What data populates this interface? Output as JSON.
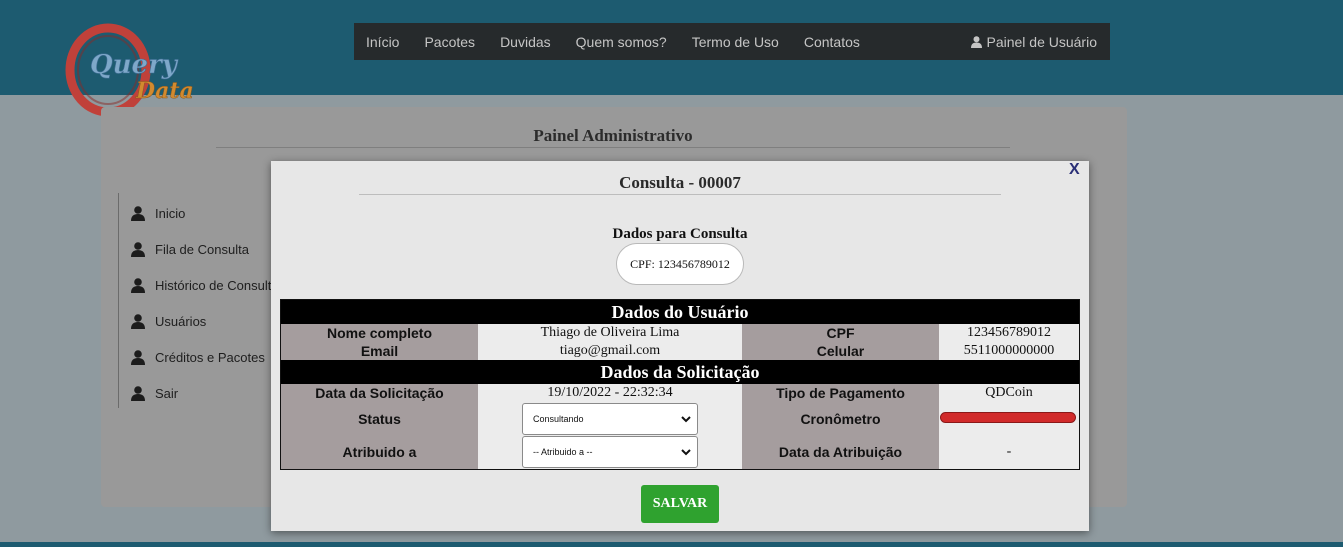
{
  "brand": {
    "logo_word1": "Query",
    "logo_word2": "Data"
  },
  "nav": {
    "items": [
      "Início",
      "Pacotes",
      "Duvidas",
      "Quem somos?",
      "Termo de Uso",
      "Contatos"
    ],
    "user_label": "Painel de Usuário",
    "user_icon": "user-icon"
  },
  "admin": {
    "title": "Painel Administrativo",
    "sidebar": [
      "Inicio",
      "Fila de Consulta",
      "Histórico de Consult",
      "Usuários",
      "Créditos e Pacotes",
      "Sair"
    ]
  },
  "modal": {
    "close_label": "X",
    "title": "Consulta - 00007",
    "consult_label": "Dados para Consulta",
    "cpf_query": "CPF: 123456789012",
    "user_section": "Dados do Usuário",
    "request_section": "Dados da Solicitação",
    "labels": {
      "nome": "Nome completo",
      "cpf": "CPF",
      "email": "Email",
      "celular": "Celular",
      "data_solicitacao": "Data da Solicitação",
      "tipo_pagamento": "Tipo de Pagamento",
      "status": "Status",
      "cronometro": "Cronômetro",
      "atribuido": "Atribuido a",
      "data_atribuicao": "Data da Atribuição"
    },
    "values": {
      "nome": "Thiago de Oliveira Lima",
      "cpf": "123456789012",
      "email": "tiago@gmail.com",
      "celular": "5511000000000",
      "data_solicitacao": "19/10/2022 - 22:32:34",
      "tipo_pagamento": "QDCoin",
      "status_selected": "Consultando",
      "atribuido_selected": "-- Atribuido a --",
      "data_atribuicao": "-"
    },
    "save_label": "SALVAR"
  },
  "colors": {
    "header": "#1d5b70",
    "navbar": "#262a2c",
    "label_cell": "#a59d9e",
    "section_header": "#000000",
    "save_button": "#2fa22f",
    "timer": "#d12a2a"
  }
}
